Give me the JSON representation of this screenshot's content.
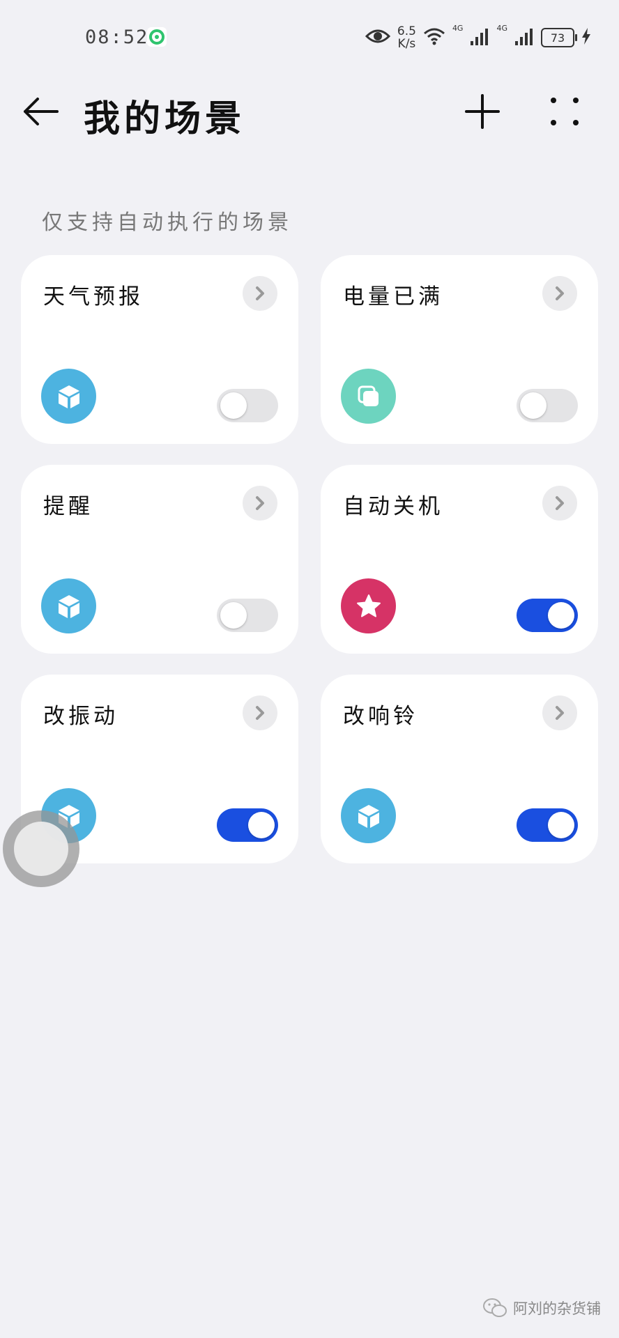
{
  "status_bar": {
    "time": "08:52",
    "net_speed_value": "6.5",
    "net_speed_unit": "K/s",
    "signal1_label": "4G",
    "signal2_label": "4G",
    "battery": "73"
  },
  "header": {
    "title": "我的场景"
  },
  "section": {
    "title": "仅支持自动执行的场景"
  },
  "scenes": [
    {
      "name": "天气预报",
      "icon": "cube-icon",
      "icon_color": "#4db3e0",
      "enabled": false
    },
    {
      "name": "电量已满",
      "icon": "copy-icon",
      "icon_color": "#6dd4bf",
      "enabled": false
    },
    {
      "name": "提醒",
      "icon": "cube-icon",
      "icon_color": "#4db3e0",
      "enabled": false
    },
    {
      "name": "自动关机",
      "icon": "star-icon",
      "icon_color": "#d63366",
      "enabled": true
    },
    {
      "name": "改振动",
      "icon": "cube-icon",
      "icon_color": "#4db3e0",
      "enabled": true
    },
    {
      "name": "改响铃",
      "icon": "cube-icon",
      "icon_color": "#4db3e0",
      "enabled": true
    }
  ],
  "colors": {
    "toggle_on": "#1a4fe0",
    "toggle_off": "#e4e4e6",
    "background": "#f1f1f5"
  },
  "watermark": {
    "text": "阿刘的杂货铺"
  }
}
